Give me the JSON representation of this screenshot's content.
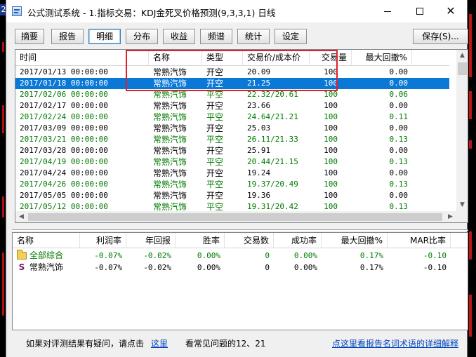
{
  "window": {
    "title": "公式测试系统 - 1.指标交易：KDJ金死叉价格预测(9,3,3,1) 日线",
    "controls": {
      "min_icon": "minimize-icon",
      "max_icon": "maximize-icon",
      "close_icon": "close-icon",
      "close_glyph": "✕"
    }
  },
  "backdrop": {
    "left_tag": "2"
  },
  "tabs": [
    {
      "label": "摘要"
    },
    {
      "label": "报告"
    },
    {
      "label": "明细"
    },
    {
      "label": "分布"
    },
    {
      "label": "收益"
    },
    {
      "label": "频谱"
    },
    {
      "label": "统计"
    },
    {
      "label": "设定"
    }
  ],
  "active_tab": "明细",
  "save_button": "保存(S)...",
  "detail_table": {
    "columns": [
      "时间",
      "名称",
      "类型",
      "交易价/成本价",
      "交易量",
      "最大回撤%"
    ],
    "rows": [
      {
        "time": "2017/01/13 00:00:00",
        "name": "常熟汽饰",
        "type": "开空",
        "price": "20.09",
        "volume": "100",
        "max_drawdown": "0.00",
        "color": "black"
      },
      {
        "time": "2017/01/18 00:00:00",
        "name": "常熟汽饰",
        "type": "开空",
        "price": "21.25",
        "volume": "100",
        "max_drawdown": "0.00",
        "color": "selected"
      },
      {
        "time": "2017/02/06 00:00:00",
        "name": "常熟汽饰",
        "type": "平空",
        "price": "22.32/20.61",
        "volume": "100",
        "max_drawdown": "0.06",
        "color": "green"
      },
      {
        "time": "2017/02/17 00:00:00",
        "name": "常熟汽饰",
        "type": "开空",
        "price": "23.66",
        "volume": "100",
        "max_drawdown": "0.00",
        "color": "black"
      },
      {
        "time": "2017/02/24 00:00:00",
        "name": "常熟汽饰",
        "type": "平空",
        "price": "24.64/21.21",
        "volume": "100",
        "max_drawdown": "0.11",
        "color": "green"
      },
      {
        "time": "2017/03/09 00:00:00",
        "name": "常熟汽饰",
        "type": "开空",
        "price": "25.03",
        "volume": "100",
        "max_drawdown": "0.00",
        "color": "black"
      },
      {
        "time": "2017/03/21 00:00:00",
        "name": "常熟汽饰",
        "type": "平空",
        "price": "26.11/21.33",
        "volume": "100",
        "max_drawdown": "0.13",
        "color": "green"
      },
      {
        "time": "2017/03/28 00:00:00",
        "name": "常熟汽饰",
        "type": "开空",
        "price": "25.91",
        "volume": "100",
        "max_drawdown": "0.00",
        "color": "black"
      },
      {
        "time": "2017/04/19 00:00:00",
        "name": "常熟汽饰",
        "type": "平空",
        "price": "20.44/21.15",
        "volume": "100",
        "max_drawdown": "0.13",
        "color": "green"
      },
      {
        "time": "2017/04/24 00:00:00",
        "name": "常熟汽饰",
        "type": "开空",
        "price": "19.24",
        "volume": "100",
        "max_drawdown": "0.00",
        "color": "black"
      },
      {
        "time": "2017/04/26 00:00:00",
        "name": "常熟汽饰",
        "type": "平空",
        "price": "19.37/20.49",
        "volume": "100",
        "max_drawdown": "0.13",
        "color": "green"
      },
      {
        "time": "2017/05/05 00:00:00",
        "name": "常熟汽饰",
        "type": "开空",
        "price": "19.36",
        "volume": "100",
        "max_drawdown": "0.00",
        "color": "black"
      },
      {
        "time": "2017/05/12 00:00:00",
        "name": "常熟汽饰",
        "type": "平空",
        "price": "19.31/20.42",
        "volume": "100",
        "max_drawdown": "0.13",
        "color": "green"
      }
    ]
  },
  "summary_table": {
    "columns": [
      "名称",
      "利润率",
      "年回报",
      "胜率",
      "交易数",
      "成功率",
      "最大回撤%",
      "MAR比率"
    ],
    "rows": [
      {
        "icon": "folder-icon",
        "name": "全部综合",
        "profit_rate": "-0.07%",
        "annual_return": "-0.02%",
        "win_rate": "0.00%",
        "trades": "0",
        "success_rate": "0.00%",
        "max_drawdown": "0.17%",
        "mar": "-0.10",
        "color": "#007a00"
      },
      {
        "icon": "stock-s-icon",
        "icon_glyph": "S",
        "name": "常熟汽饰",
        "profit_rate": "-0.07%",
        "annual_return": "-0.02%",
        "win_rate": "0.00%",
        "trades": "0",
        "success_rate": "0.00%",
        "max_drawdown": "0.17%",
        "mar": "-0.10",
        "color": "#000000"
      }
    ]
  },
  "footer": {
    "prefix": "如果对评测结果有疑问，请点击",
    "link1": "这里",
    "middle": "看常见问题的12、21",
    "link2": "点这里看报告名词术语的详细解释"
  },
  "colors": {
    "selection": "#0a78d7",
    "close_row_green": "#007a00",
    "highlight_box": "#e0202a",
    "link": "#0045c0"
  }
}
